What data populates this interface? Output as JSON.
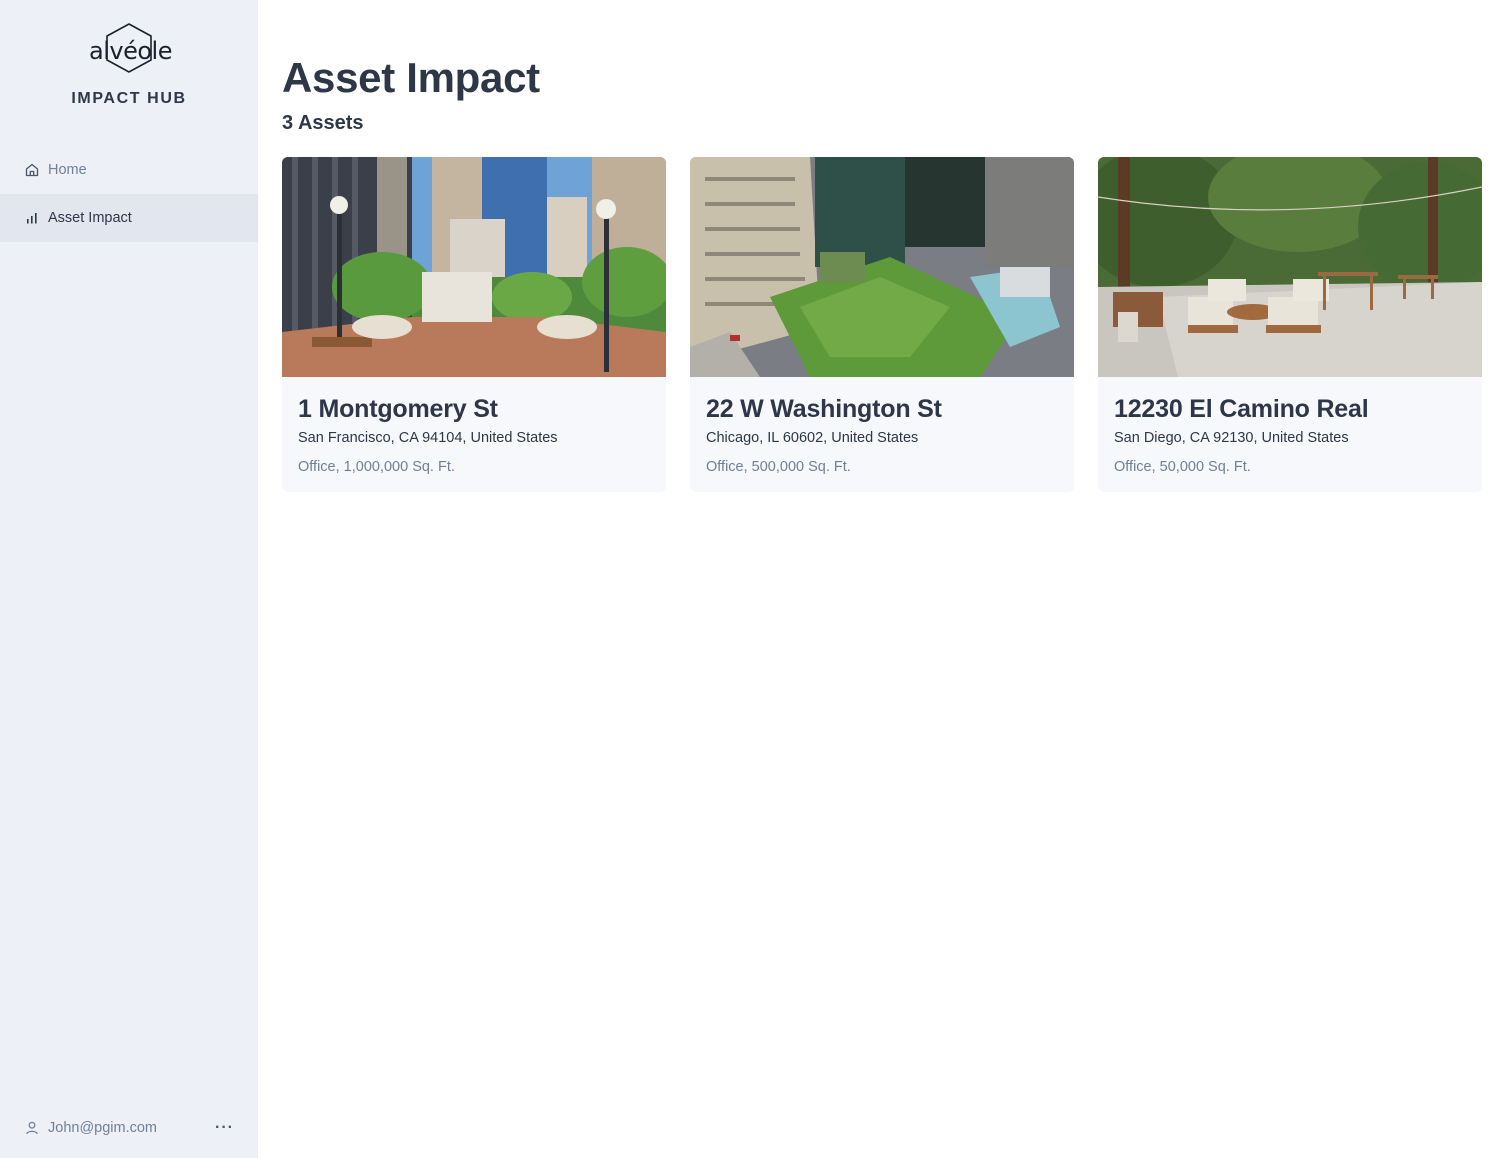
{
  "brand": {
    "logo_word": "alvéole",
    "hub_title": "IMPACT HUB"
  },
  "sidebar": {
    "items": [
      {
        "label": "Home",
        "icon": "home-icon",
        "active": false
      },
      {
        "label": "Asset Impact",
        "icon": "bar-chart-icon",
        "active": true
      }
    ],
    "user": {
      "email": "John@pgim.com",
      "more_label": "···"
    }
  },
  "main": {
    "title": "Asset Impact",
    "count": "3 Assets",
    "assets": [
      {
        "name": "1 Montgomery St",
        "address": "San Francisco, CA 94104, United States",
        "meta": "Office, 1,000,000 Sq. Ft.",
        "photo": "city-plaza-photo"
      },
      {
        "name": "22 W Washington St",
        "address": "Chicago, IL 60602, United States",
        "meta": "Office, 500,000 Sq. Ft.",
        "photo": "green-roof-aerial-photo"
      },
      {
        "name": "12230 El Camino Real",
        "address": "San Diego, CA 92130, United States",
        "meta": "Office, 50,000 Sq. Ft.",
        "photo": "patio-garden-photo"
      }
    ]
  },
  "colors": {
    "sidebar_bg": "#edf0f7",
    "active_bg": "#e2e6ef",
    "text_dark": "#2d3748",
    "text_muted": "#718096",
    "card_bg": "#f7f8fb"
  }
}
